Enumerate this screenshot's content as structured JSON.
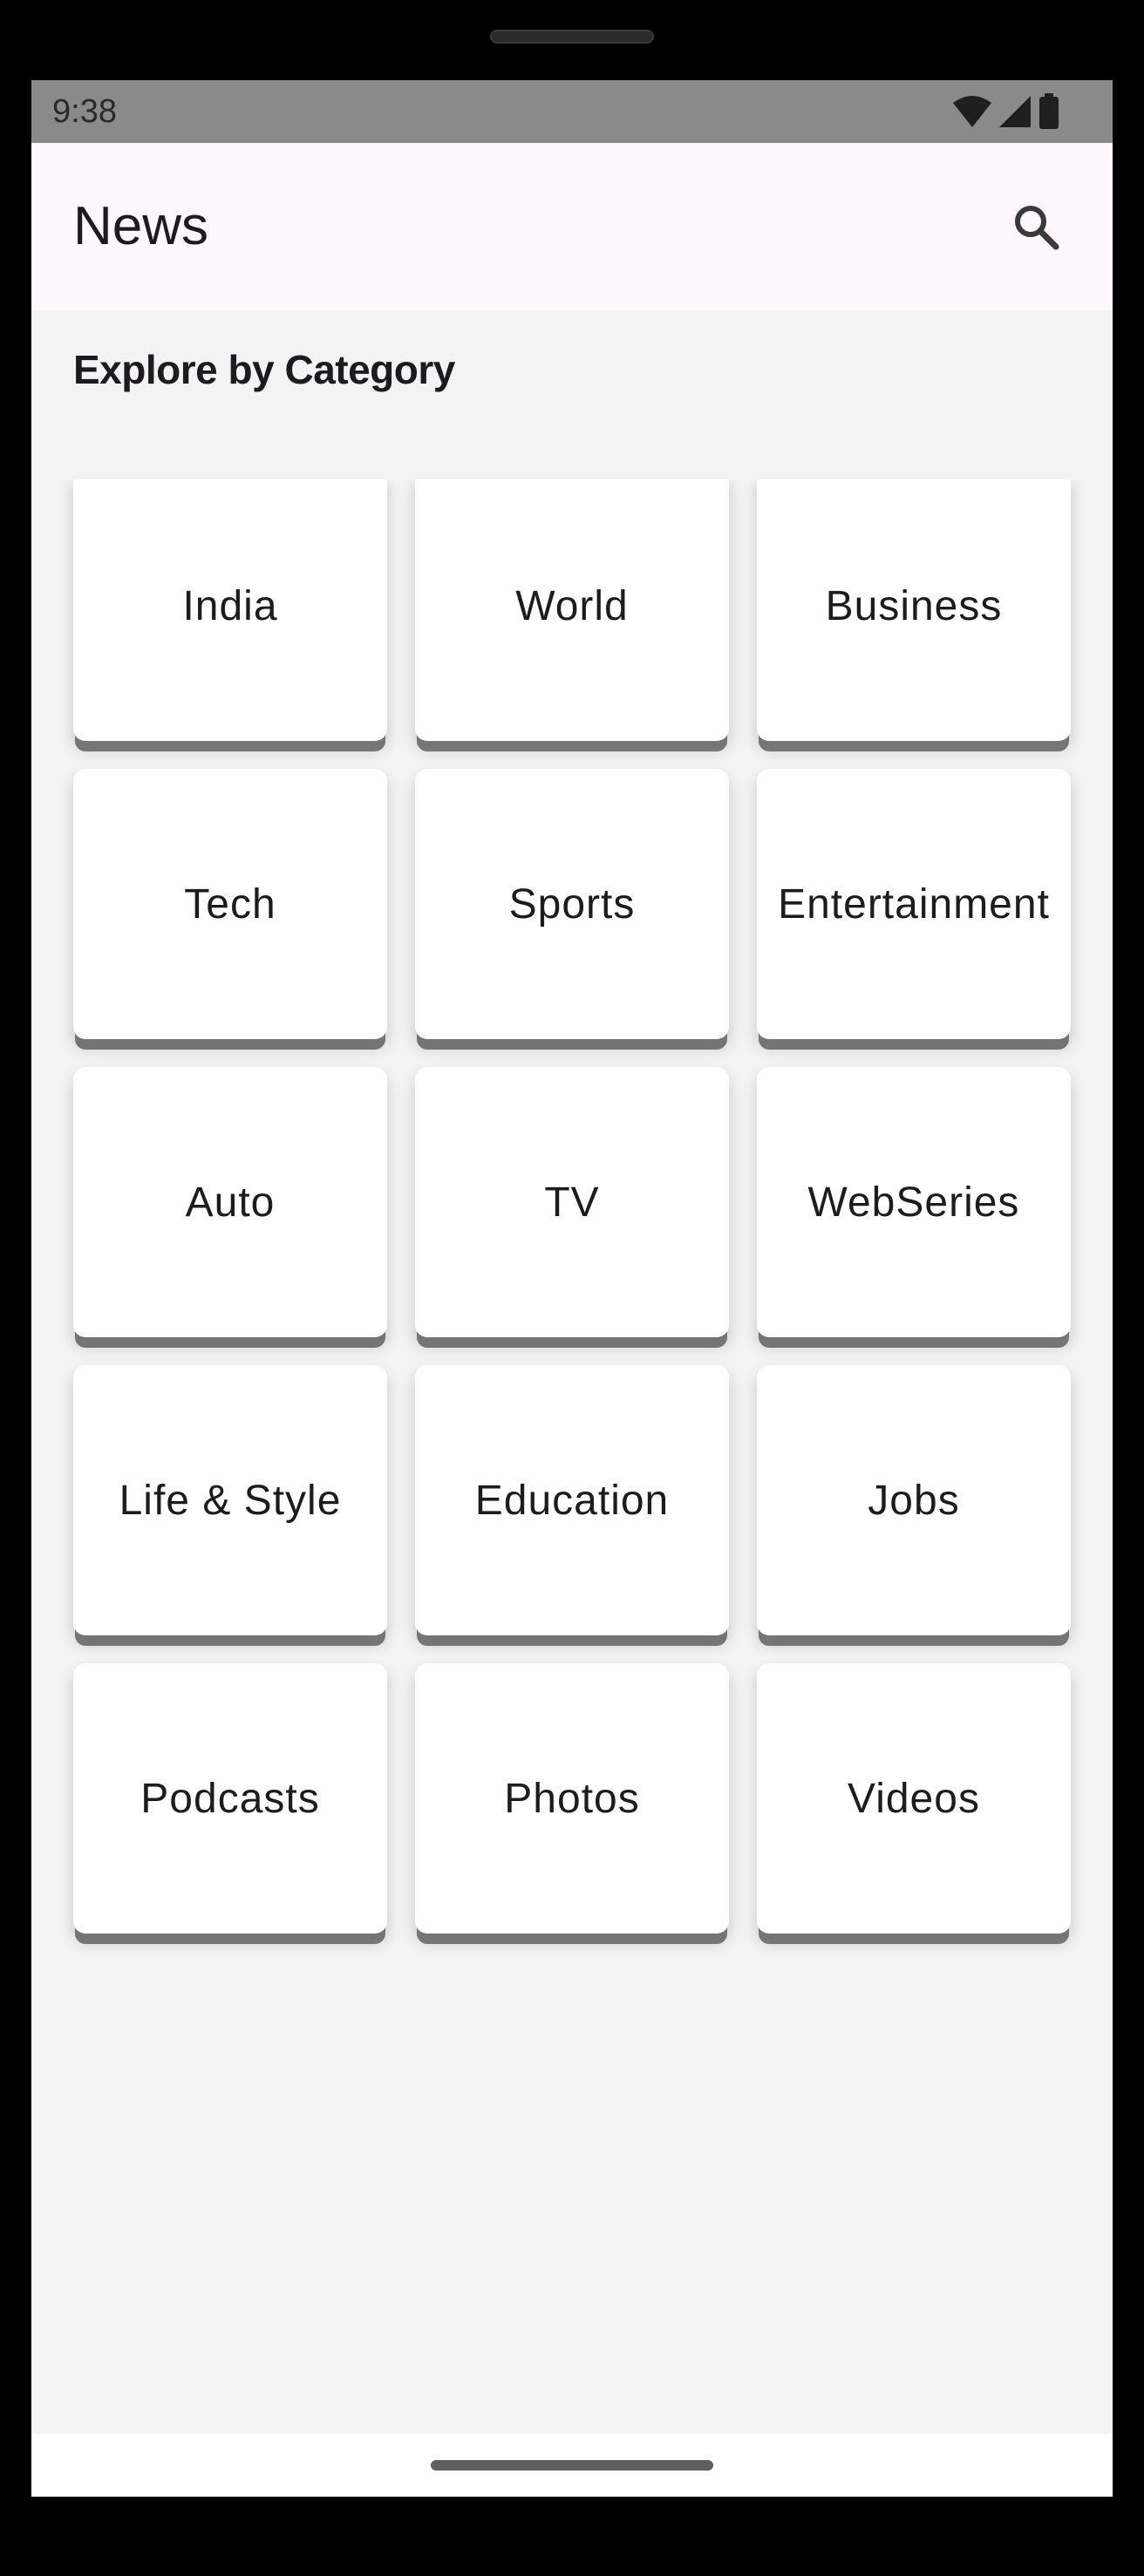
{
  "status_bar": {
    "time": "9:38",
    "icons": [
      "wifi-icon",
      "cellular-signal-icon",
      "battery-icon"
    ]
  },
  "app_bar": {
    "title": "News",
    "search_icon": "search-icon"
  },
  "section": {
    "title": "Explore by Category"
  },
  "categories": [
    {
      "label": "India"
    },
    {
      "label": "World"
    },
    {
      "label": "Business"
    },
    {
      "label": "Tech"
    },
    {
      "label": "Sports"
    },
    {
      "label": "Entertainment"
    },
    {
      "label": "Auto"
    },
    {
      "label": "TV"
    },
    {
      "label": "WebSeries"
    },
    {
      "label": "Life & Style"
    },
    {
      "label": "Education"
    },
    {
      "label": "Jobs"
    },
    {
      "label": "Podcasts"
    },
    {
      "label": "Photos"
    },
    {
      "label": "Videos"
    }
  ],
  "colors": {
    "app_bar_bg": "#fef7fc",
    "screen_bg": "#f3f3f3",
    "card_bg": "#ffffff",
    "card_edge": "#757575",
    "status_bar_bg": "#8a8a8a",
    "text": "#1d1b20"
  }
}
